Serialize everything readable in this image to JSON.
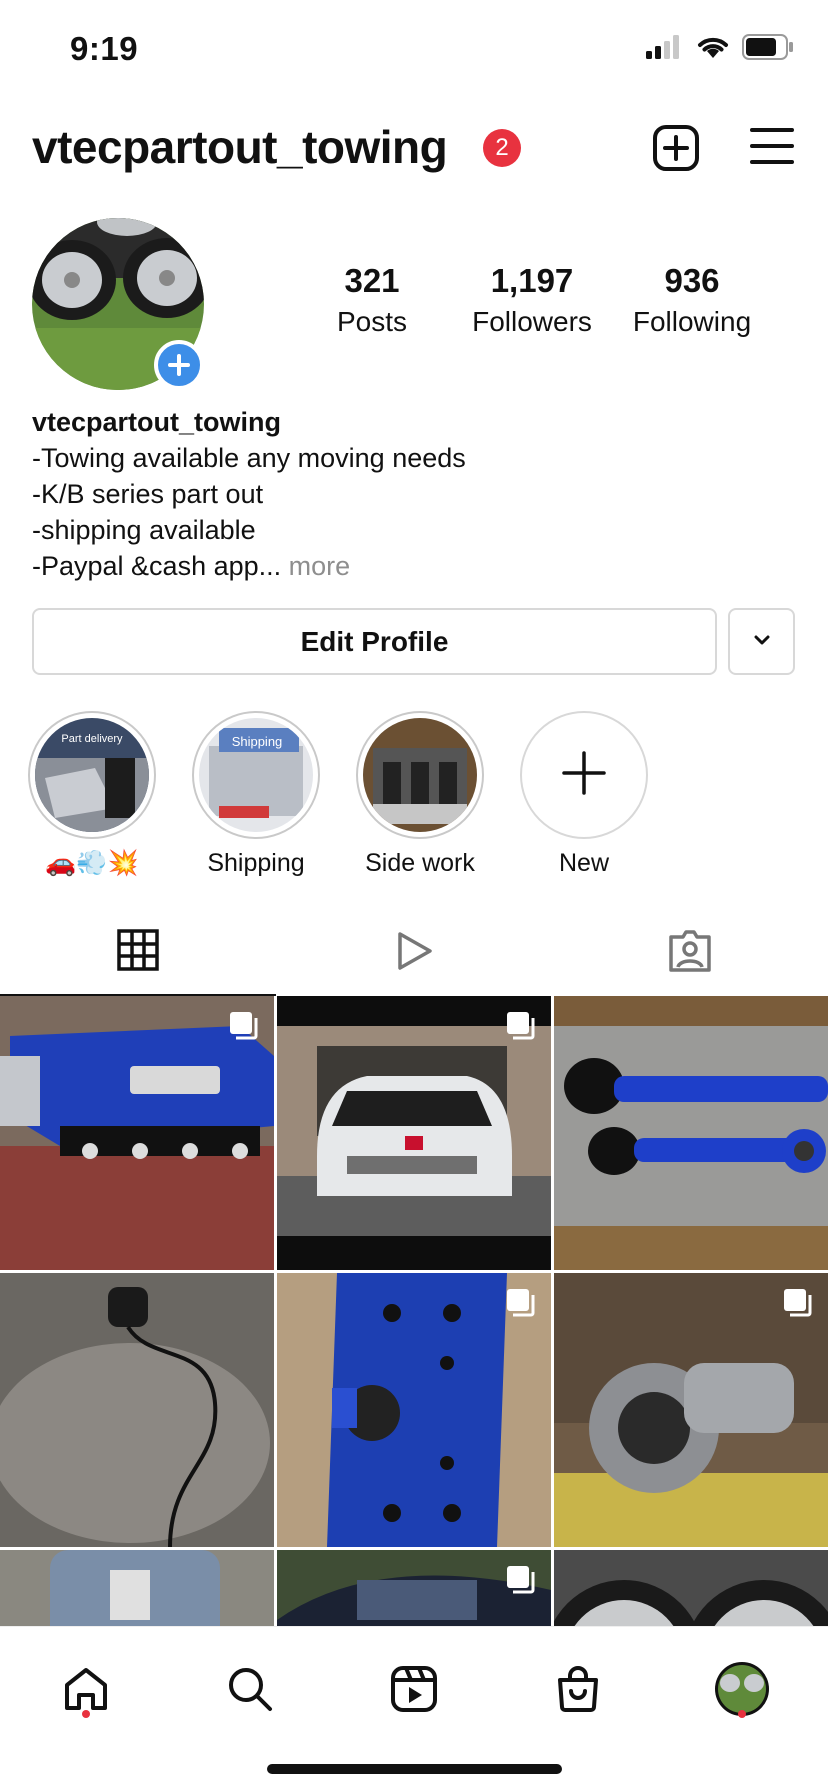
{
  "status_bar": {
    "time": "9:19"
  },
  "header": {
    "username": "vtecpartout_towing",
    "notification_count": "2",
    "icons": [
      "new-post-icon",
      "menu-icon"
    ]
  },
  "profile": {
    "stats": {
      "posts": {
        "value": "321",
        "label": "Posts"
      },
      "followers": {
        "value": "1,197",
        "label": "Followers"
      },
      "following": {
        "value": "936",
        "label": "Following"
      }
    },
    "bio": {
      "name": "vtecpartout_towing",
      "lines": [
        "-Towing available any moving needs",
        "-K/B series part out",
        "-shipping available",
        "-Paypal &cash app..."
      ],
      "more": "more"
    },
    "edit_profile_label": "Edit Profile"
  },
  "highlights": [
    {
      "label": "🚗💨💥",
      "image_text": "Part delivery"
    },
    {
      "label": "Shipping",
      "image_text": "Shipping"
    },
    {
      "label": "Side work",
      "image_text": ""
    },
    {
      "label": "New",
      "image_text": ""
    }
  ],
  "tabs": [
    "grid-icon",
    "reels-icon",
    "tagged-icon"
  ],
  "nav": [
    "home-icon",
    "search-icon",
    "reels-icon",
    "shop-icon",
    "profile-avatar"
  ],
  "colors": {
    "badge": "#e8323f",
    "avatar_plus": "#3d8ee8",
    "text": "#111111",
    "muted": "#8e8e8e"
  }
}
